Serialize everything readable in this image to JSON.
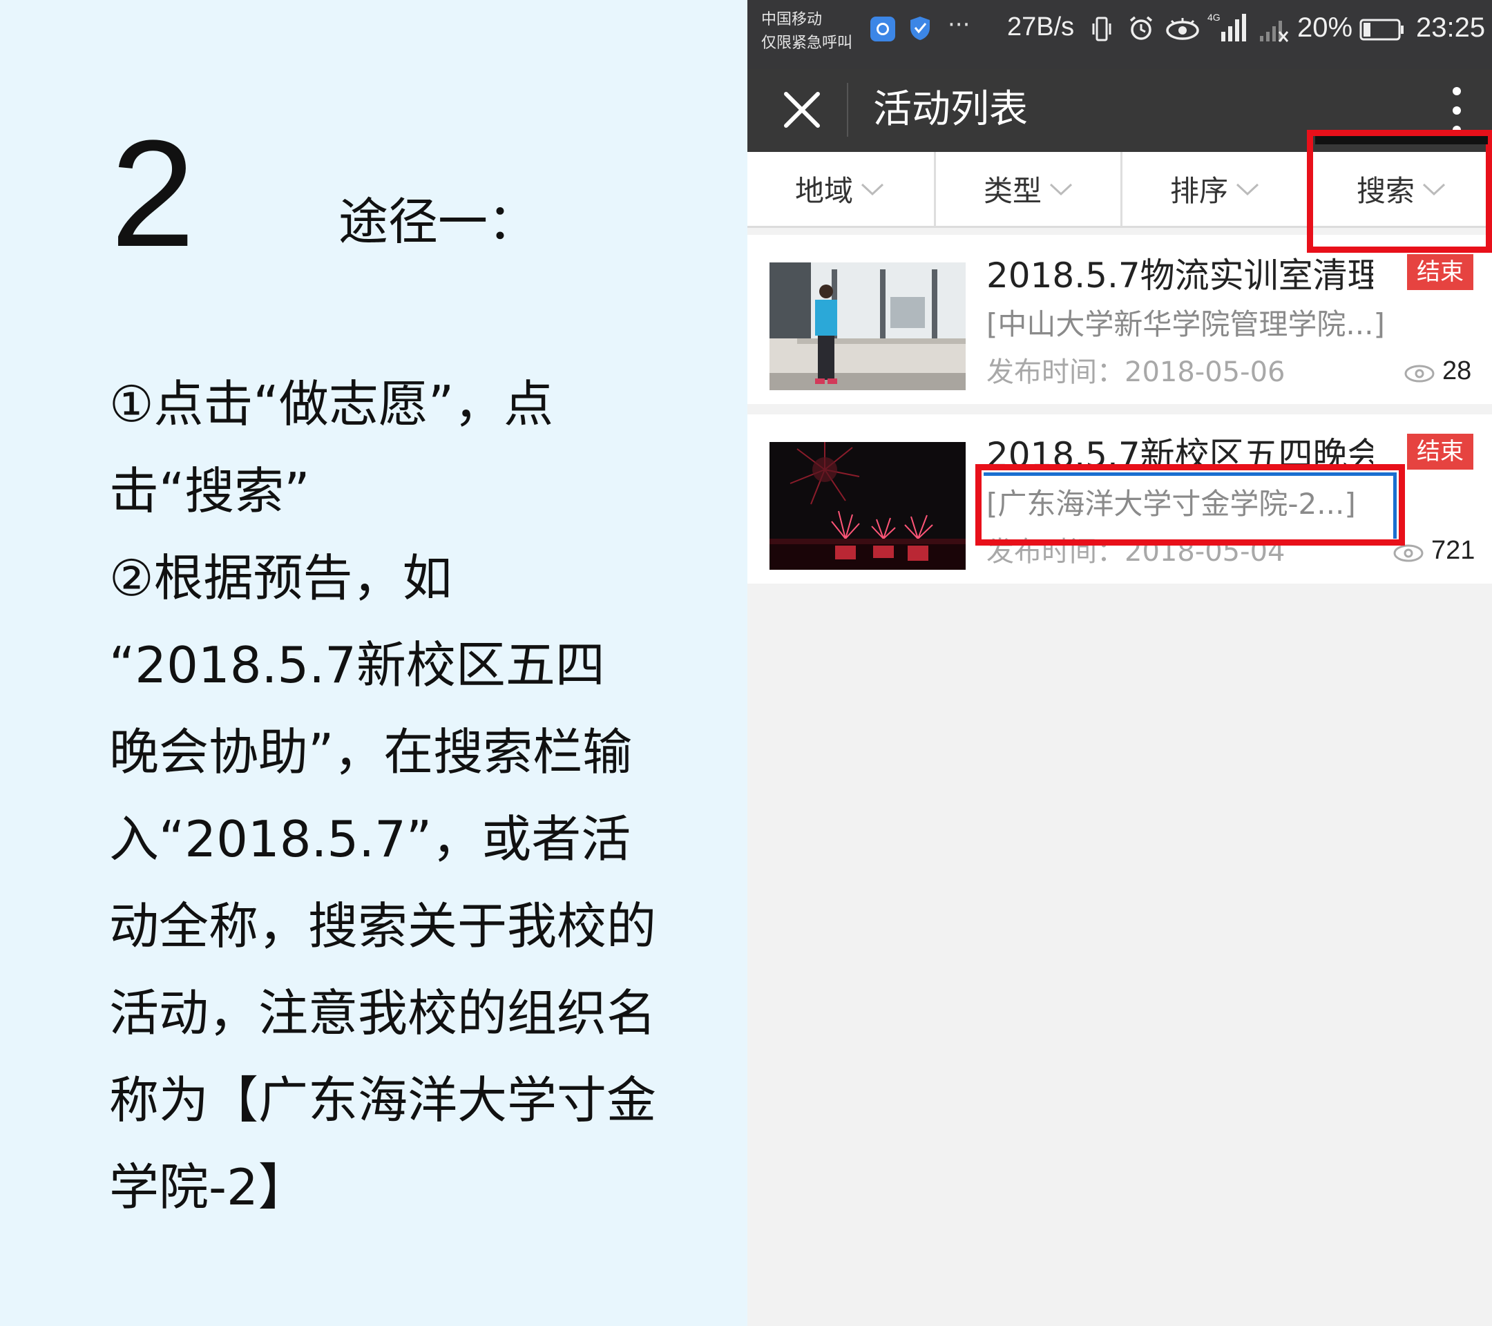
{
  "instruction": {
    "step_number": "2",
    "route_label": "途径一：",
    "lines": [
      "①点击“做志愿”，点",
      "击“搜索”",
      "②根据预告，如",
      "“2018.5.7新校区五四",
      "晚会协助”，在搜索栏输",
      "入“2018.5.7”，或者活",
      "动全称，搜索关于我校的",
      "活动，注意我校的组织名",
      "称为【广东海洋大学寸金",
      "学院-2】"
    ]
  },
  "status_bar": {
    "carrier_lines": [
      "中国移动",
      "仅限紧急呼叫"
    ],
    "net_speed": "27B/s",
    "battery_percent": "20%",
    "time": "23:25",
    "signal_label": "4G",
    "more_dots": "···"
  },
  "titlebar": {
    "title": "活动列表"
  },
  "filter_tabs": [
    {
      "label": "地域"
    },
    {
      "label": "类型"
    },
    {
      "label": "排序"
    },
    {
      "label": "搜索"
    }
  ],
  "activities": [
    {
      "title": "2018.5.7物流实训室清理…",
      "organization": "[中山大学新华学院管理学院...]",
      "publish_label": "发布时间：",
      "publish_date": "2018-05-06",
      "status": "结束",
      "views": "28"
    },
    {
      "title": "2018.5.7新校区五四晚会…",
      "organization": "[广东海洋大学寸金学院-2...]",
      "publish_label": "发布时间：",
      "publish_date": "2018-05-04",
      "status": "结束",
      "views": "721"
    }
  ],
  "colors": {
    "left_background": "#e8f6fd",
    "header_background": "#383838",
    "highlight": "#e8101a",
    "status_badge": "#e64340"
  }
}
